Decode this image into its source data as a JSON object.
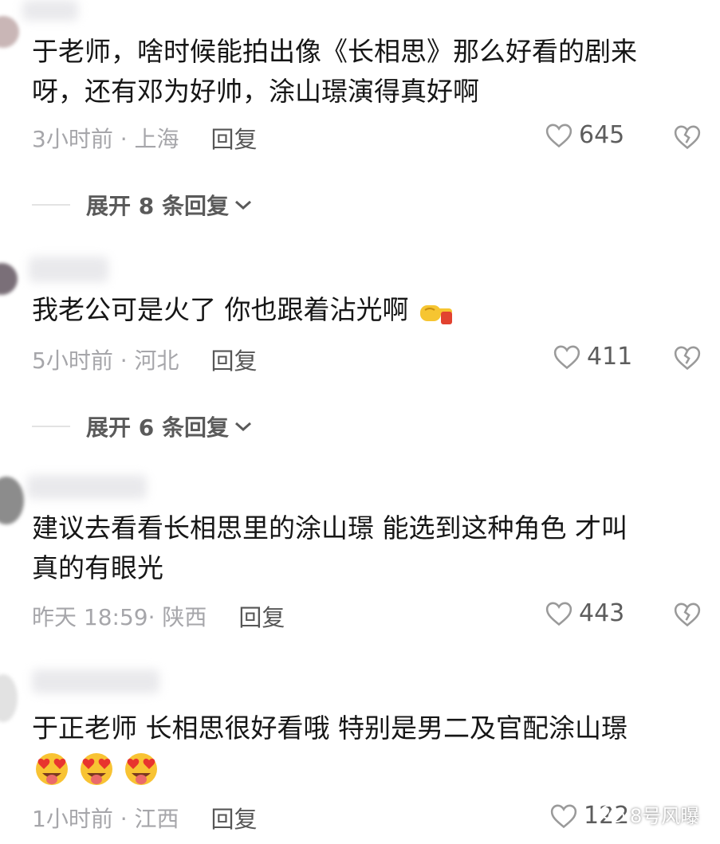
{
  "comments": [
    {
      "text_line1": "于老师，啥时候能拍出像《长相思》那么好看的剧来",
      "text_line2": "呀，还有邓为好帅，涂山璟演得真好啊",
      "time_location": "3小时前 · 上海",
      "reply_label": "回复",
      "likes": "645",
      "expand_label": "展开 8 条回复"
    },
    {
      "text_line1": "我老公可是火了 你也跟着沾光啊",
      "emoji": "pointing-hand-emoji",
      "time_location": "5小时前 · 河北",
      "reply_label": "回复",
      "likes": "411",
      "expand_label": "展开 6 条回复"
    },
    {
      "text_line1": "建议去看看长相思里的涂山璟 能选到这种角色 才叫",
      "text_line2": "真的有眼光",
      "time_location": "昨天 18:59· 陕西",
      "reply_label": "回复",
      "likes": "443"
    },
    {
      "text_line1": "于正老师 长相思很好看哦 特别是男二及官配涂山璟",
      "emojis": [
        "heart-eyes-tongue-emoji",
        "heart-eyes-tongue-emoji",
        "heart-eyes-tongue-emoji"
      ],
      "time_location": "1小时前 · 江西",
      "reply_label": "回复",
      "likes": "122"
    }
  ],
  "watermark": {
    "text": "8号风曝",
    "icon": "wechat-icon"
  },
  "colors": {
    "text": "#161616",
    "meta": "#a6a6aa",
    "reply": "#565656",
    "expand": "#5a5a5a",
    "icon_stroke": "#9a9a9a"
  }
}
